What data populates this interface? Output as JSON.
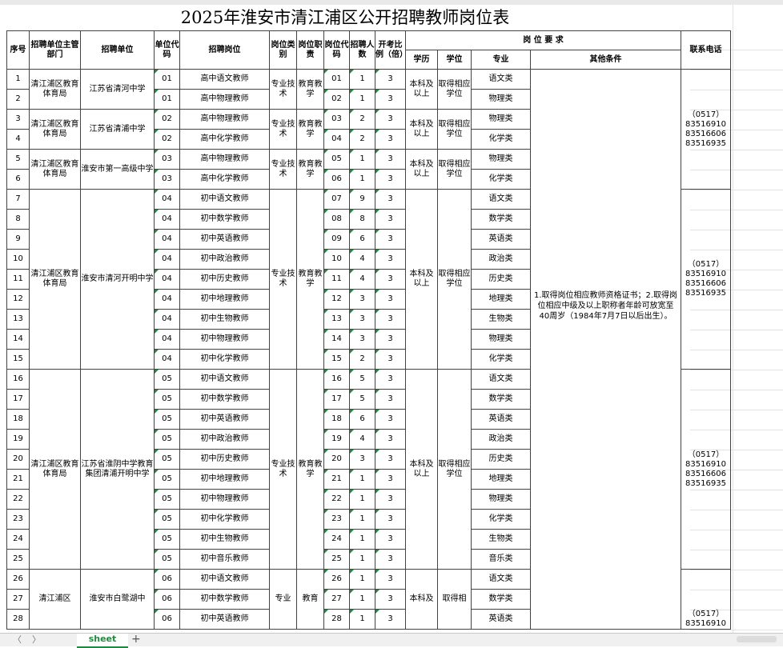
{
  "sheet": {
    "title": "2025年淮安市清江浦区公开招聘教师岗位表",
    "headers": {
      "seq": "序号",
      "dept": "招聘单位主管部门",
      "unit": "招聘单位",
      "unit_code": "单位代码",
      "position": "招聘岗位",
      "category": "岗位类别",
      "duty": "岗位职责",
      "pos_code": "岗位代码",
      "count": "招聘人数",
      "ratio": "开考比例（倍）",
      "req_group": "岗 位 要 求",
      "edu": "学历",
      "degree": "学位",
      "major": "专业",
      "other": "其他条件",
      "phone": "联系电话"
    },
    "rows": [
      {
        "seq": "1",
        "unit_code": "01",
        "position": "高中语文教师",
        "pos_code": "01",
        "count": "1",
        "ratio": "3",
        "major": "语文类"
      },
      {
        "seq": "2",
        "unit_code": "01",
        "position": "高中物理教师",
        "pos_code": "02",
        "count": "1",
        "ratio": "3",
        "major": "物理类"
      },
      {
        "seq": "3",
        "unit_code": "02",
        "position": "高中物理教师",
        "pos_code": "03",
        "count": "2",
        "ratio": "3",
        "major": "物理类"
      },
      {
        "seq": "4",
        "unit_code": "02",
        "position": "高中化学教师",
        "pos_code": "04",
        "count": "2",
        "ratio": "3",
        "major": "化学类"
      },
      {
        "seq": "5",
        "unit_code": "03",
        "position": "高中物理教师",
        "pos_code": "05",
        "count": "1",
        "ratio": "3",
        "major": "物理类"
      },
      {
        "seq": "6",
        "unit_code": "03",
        "position": "高中化学教师",
        "pos_code": "06",
        "count": "1",
        "ratio": "3",
        "major": "化学类"
      },
      {
        "seq": "7",
        "unit_code": "04",
        "position": "初中语文教师",
        "pos_code": "07",
        "count": "9",
        "ratio": "3",
        "major": "语文类"
      },
      {
        "seq": "8",
        "unit_code": "04",
        "position": "初中数学教师",
        "pos_code": "08",
        "count": "8",
        "ratio": "3",
        "major": "数学类"
      },
      {
        "seq": "9",
        "unit_code": "04",
        "position": "初中英语教师",
        "pos_code": "09",
        "count": "6",
        "ratio": "3",
        "major": "英语类"
      },
      {
        "seq": "10",
        "unit_code": "04",
        "position": "初中政治教师",
        "pos_code": "10",
        "count": "4",
        "ratio": "3",
        "major": "政治类"
      },
      {
        "seq": "11",
        "unit_code": "04",
        "position": "初中历史教师",
        "pos_code": "11",
        "count": "4",
        "ratio": "3",
        "major": "历史类"
      },
      {
        "seq": "12",
        "unit_code": "04",
        "position": "初中地理教师",
        "pos_code": "12",
        "count": "3",
        "ratio": "3",
        "major": "地理类"
      },
      {
        "seq": "13",
        "unit_code": "04",
        "position": "初中生物教师",
        "pos_code": "13",
        "count": "3",
        "ratio": "3",
        "major": "生物类"
      },
      {
        "seq": "14",
        "unit_code": "04",
        "position": "初中物理教师",
        "pos_code": "14",
        "count": "3",
        "ratio": "3",
        "major": "物理类"
      },
      {
        "seq": "15",
        "unit_code": "04",
        "position": "初中化学教师",
        "pos_code": "15",
        "count": "2",
        "ratio": "3",
        "major": "化学类"
      },
      {
        "seq": "16",
        "unit_code": "05",
        "position": "初中语文教师",
        "pos_code": "16",
        "count": "5",
        "ratio": "3",
        "major": "语文类"
      },
      {
        "seq": "17",
        "unit_code": "05",
        "position": "初中数学教师",
        "pos_code": "17",
        "count": "5",
        "ratio": "3",
        "major": "数学类"
      },
      {
        "seq": "18",
        "unit_code": "05",
        "position": "初中英语教师",
        "pos_code": "18",
        "count": "6",
        "ratio": "3",
        "major": "英语类"
      },
      {
        "seq": "19",
        "unit_code": "05",
        "position": "初中政治教师",
        "pos_code": "19",
        "count": "4",
        "ratio": "3",
        "major": "政治类"
      },
      {
        "seq": "20",
        "unit_code": "05",
        "position": "初中历史教师",
        "pos_code": "20",
        "count": "3",
        "ratio": "3",
        "major": "历史类"
      },
      {
        "seq": "21",
        "unit_code": "05",
        "position": "初中地理教师",
        "pos_code": "21",
        "count": "1",
        "ratio": "3",
        "major": "地理类"
      },
      {
        "seq": "22",
        "unit_code": "05",
        "position": "初中物理教师",
        "pos_code": "22",
        "count": "1",
        "ratio": "3",
        "major": "物理类"
      },
      {
        "seq": "23",
        "unit_code": "05",
        "position": "初中化学教师",
        "pos_code": "23",
        "count": "1",
        "ratio": "3",
        "major": "化学类"
      },
      {
        "seq": "24",
        "unit_code": "05",
        "position": "初中生物教师",
        "pos_code": "24",
        "count": "1",
        "ratio": "3",
        "major": "生物类"
      },
      {
        "seq": "25",
        "unit_code": "05",
        "position": "初中音乐教师",
        "pos_code": "25",
        "count": "1",
        "ratio": "3",
        "major": "音乐类"
      },
      {
        "seq": "26",
        "unit_code": "06",
        "position": "初中语文教师",
        "pos_code": "26",
        "count": "1",
        "ratio": "3",
        "major": "语文类"
      },
      {
        "seq": "27",
        "unit_code": "06",
        "position": "初中数学教师",
        "pos_code": "27",
        "count": "1",
        "ratio": "3",
        "major": "数学类"
      },
      {
        "seq": "28",
        "unit_code": "06",
        "position": "初中英语教师",
        "pos_code": "28",
        "count": "1",
        "ratio": "3",
        "major": "英语类"
      }
    ],
    "groups": [
      {
        "dept": "清江浦区教育体育局",
        "unit": "江苏省清河中学",
        "category": "专业技术",
        "duty": "教育教学",
        "edu": "本科及以上",
        "degree": "取得相应学位"
      },
      {
        "dept": "清江浦区教育体育局",
        "unit": "江苏省清浦中学",
        "category": "专业技术",
        "duty": "教育教学",
        "edu": "本科及以上",
        "degree": "取得相应学位"
      },
      {
        "dept": "清江浦区教育体育局",
        "unit": "淮安市第一高级中学",
        "category": "专业技术",
        "duty": "教育教学",
        "edu": "本科及以上",
        "degree": "取得相应学位"
      },
      {
        "dept": "清江浦区教育体育局",
        "unit": "淮安市清河开明中学",
        "category": "专业技术",
        "duty": "教育教学",
        "edu": "本科及以上",
        "degree": "取得相应学位"
      },
      {
        "dept": "清江浦区教育体育局",
        "unit": "江苏省淮阴中学教育集团清浦开明中学",
        "category": "专业技术",
        "duty": "教育教学",
        "edu": "本科及以上",
        "degree": "取得相应学位"
      },
      {
        "dept": "清江浦区",
        "unit": "淮安市白鹭湖中",
        "category": "专业",
        "duty": "教育",
        "edu": "本科及",
        "degree": "取得相"
      }
    ],
    "other_conditions": "1.取得岗位相应教师资格证书；2.取得岗位相应中级及以上职称者年龄可放宽至40周岁（1984年7月7日以后出生）。",
    "phones": [
      "（0517）83516910 83516606 83516935",
      "（0517）83516910 83516606 83516935",
      "（0517）83516910 83516606 83516935",
      "（0517）83516910"
    ]
  },
  "tabs": {
    "active": "sheet",
    "add": "+",
    "prev": "〈",
    "next": "〉"
  }
}
